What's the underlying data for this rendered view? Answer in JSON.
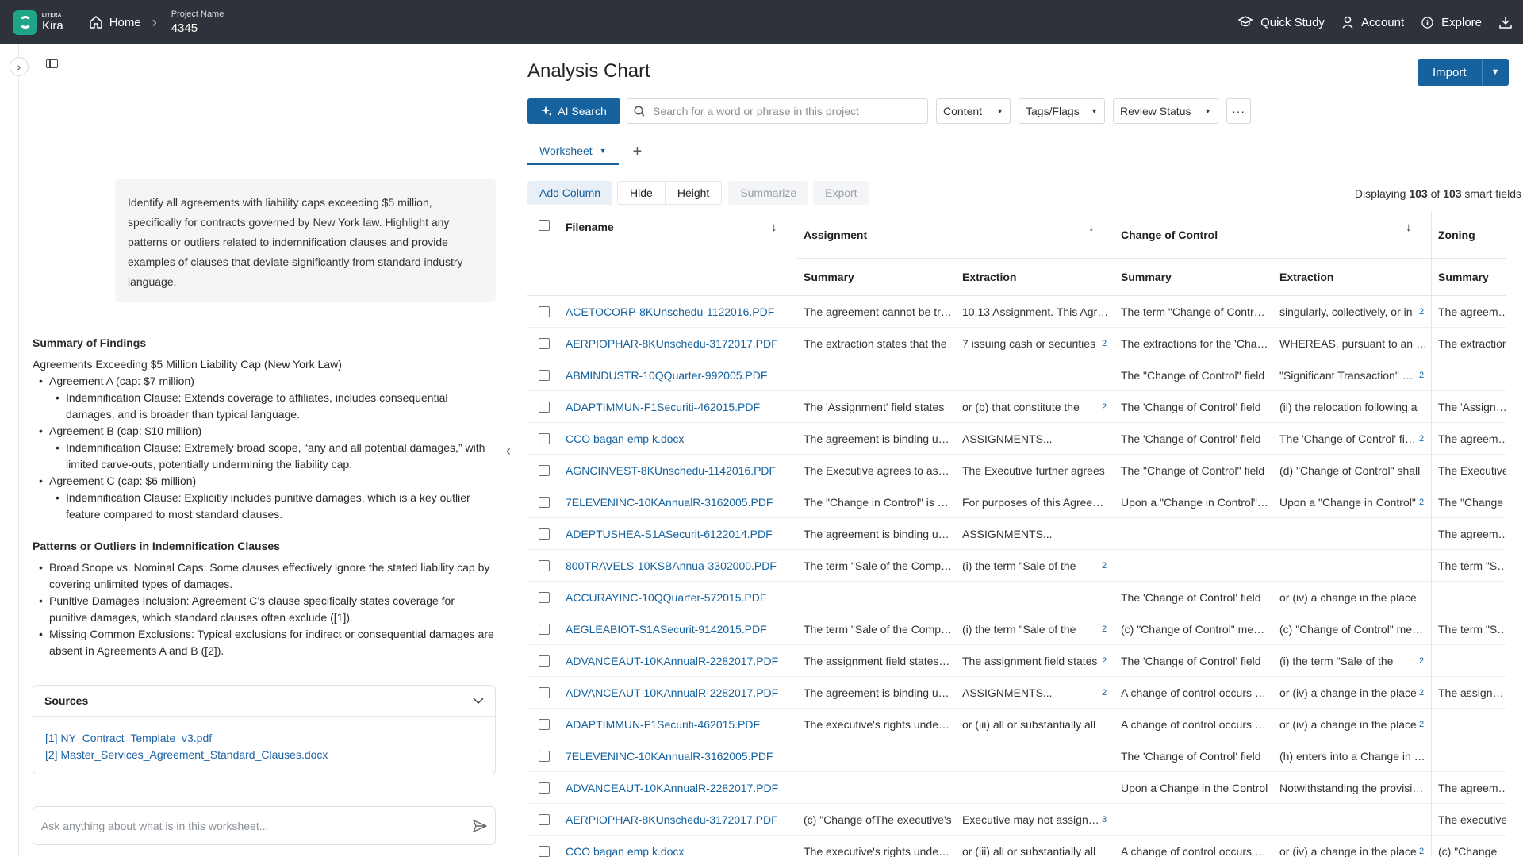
{
  "topbar": {
    "brand_small": "LITERA",
    "brand_name": "Kira",
    "home_label": "Home",
    "project_label": "Project Name",
    "project_value": "4345",
    "quick_study": "Quick Study",
    "account": "Account",
    "explore": "Explore"
  },
  "left": {
    "prompt": "Identify all agreements with liability caps exceeding $5 million, specifically for contracts governed by New York law. Highlight any patterns or outliers related to indemnification clauses and provide examples of clauses that deviate significantly from standard industry language.",
    "summary_heading": "Summary of Findings",
    "summary_intro": "Agreements Exceeding $5 Million Liability Cap (New York Law)",
    "agreement_a": "Agreement A (cap: $7 million)",
    "agreement_a_clause": "Indemnification Clause: Extends coverage to affiliates, includes consequential damages, and is broader than typical language.",
    "agreement_b": "Agreement B (cap: $10 million)",
    "agreement_b_clause": "Indemnification Clause: Extremely broad scope, “any and all potential damages,” with limited carve-outs, potentially undermining the liability cap.",
    "agreement_c": "Agreement C (cap: $6 million)",
    "agreement_c_clause": "Indemnification Clause: Explicitly includes punitive damages, which is a key outlier feature compared to most standard clauses.",
    "patterns_heading": "Patterns or Outliers in Indemnification Clauses",
    "pattern_1": "Broad Scope vs. Nominal Caps: Some clauses effectively ignore the stated liability cap by covering unlimited types of damages.",
    "pattern_2": "Punitive Damages Inclusion: Agreement C’s clause specifically states coverage for punitive damages, which standard clauses often exclude ([1]).",
    "pattern_3": "Missing Common Exclusions: Typical exclusions for indirect or consequential damages are absent in Agreements A and B ([2]).",
    "sources_title": "Sources",
    "source_1": "[1] NY_Contract_Template_v3.pdf",
    "source_2": "[2] Master_Services_Agreement_Standard_Clauses.docx",
    "ask_placeholder": "Ask anything about what is in this worksheet..."
  },
  "main": {
    "title": "Analysis Chart",
    "import_label": "Import",
    "ai_search_label": "AI Search",
    "search_placeholder": "Search for a word or phrase in this project",
    "filter_content": "Content",
    "filter_tags": "Tags/Flags",
    "filter_review": "Review Status",
    "more_label": "···",
    "tab_worksheet": "Worksheet",
    "add_tab": "+",
    "btn_add_column": "Add Column",
    "btn_hide": "Hide",
    "btn_height": "Height",
    "btn_summarize": "Summarize",
    "btn_export": "Export",
    "display_prefix": "Displaying",
    "display_shown": "103",
    "display_of": "of",
    "display_total": "103",
    "display_suffix": "smart fields"
  },
  "table": {
    "col_filename": "Filename",
    "col_assignment": "Assignment",
    "col_change_of_control": "Change of Control",
    "col_zoning": "Zoning",
    "sub_summary": "Summary",
    "sub_extraction": "Extraction",
    "rows": [
      {
        "file": "ACETOCORP-8KUnschedu-1122016.PDF",
        "a_sum": "The agreement cannot be transferred",
        "a_ext": "10.13 Assignment. This Agreement",
        "a_badge": "",
        "c_sum": "The term \"Change of Control\" means",
        "c_ext": "singularly, collectively, or in",
        "c_badge": "2",
        "z_sum": "The agreement"
      },
      {
        "file": "AERPIOPHAR-8KUnschedu-3172017.PDF",
        "a_sum": "The extraction states that the",
        "a_ext": "7 issuing cash or securities",
        "a_badge": "2",
        "c_sum": "The extractions for the 'Change",
        "c_ext": "WHEREAS, pursuant to an agreement",
        "c_badge": "",
        "z_sum": "The extraction"
      },
      {
        "file": "ABMINDUSTR-10QQuarter-992005.PDF",
        "a_sum": "",
        "a_ext": "",
        "a_badge": "",
        "c_sum": "The \"Change of Control\" field",
        "c_ext": "\"Significant Transaction\" means",
        "c_badge": "2",
        "z_sum": ""
      },
      {
        "file": "ADAPTIMMUN-F1Securiti-462015.PDF",
        "a_sum": "The 'Assignment' field states",
        "a_ext": "or (b) that constitute the",
        "a_badge": "2",
        "c_sum": "The 'Change of Control' field",
        "c_ext": "(ii) the relocation following a",
        "c_badge": "",
        "z_sum": "The 'Assignment'"
      },
      {
        "file": "CCO bagan emp k.docx",
        "a_sum": "The agreement is binding upon",
        "a_ext": "ASSIGNMENTS...",
        "a_badge": "",
        "c_sum": "The 'Change of Control' field",
        "c_ext": "The 'Change of Control' field",
        "c_badge": "2",
        "z_sum": "The agreement"
      },
      {
        "file": "AGNCINVEST-8KUnschedu-1142016.PDF",
        "a_sum": "The Executive agrees to assign",
        "a_ext": "The Executive further agrees",
        "a_badge": "",
        "c_sum": "The \"Change of Control\" field",
        "c_ext": "(d) \"Change of Control\" shall",
        "c_badge": "",
        "z_sum": "The Executive"
      },
      {
        "file": "7ELEVENINC-10KAnnualR-3162005.PDF",
        "a_sum": "The \"Change in Control\" is defined",
        "a_ext": "For purposes of this Agreement",
        "a_badge": "",
        "c_sum": "Upon a \"Change in Control\" the",
        "c_ext": "Upon a \"Change in Control\"",
        "c_badge": "2",
        "z_sum": "The \"Change"
      },
      {
        "file": "ADEPTUSHEA-S1ASecurit-6122014.PDF",
        "a_sum": "The agreement is binding upon",
        "a_ext": "ASSIGNMENTS...",
        "a_badge": "",
        "c_sum": "",
        "c_ext": "",
        "c_badge": "",
        "z_sum": "The agreement"
      },
      {
        "file": "800TRAVELS-10KSBAnnua-3302000.PDF",
        "a_sum": "The term \"Sale of the Company\"",
        "a_ext": "(i) the term \"Sale of the",
        "a_badge": "2",
        "c_sum": "",
        "c_ext": "",
        "c_badge": "",
        "z_sum": "The term \"Sale"
      },
      {
        "file": "ACCURAYINC-10QQuarter-572015.PDF",
        "a_sum": "",
        "a_ext": "",
        "a_badge": "",
        "c_sum": "The 'Change of Control' field",
        "c_ext": "or (iv) a change in the place",
        "c_badge": "",
        "z_sum": ""
      },
      {
        "file": "AEGLEABIOT-S1ASecurit-9142015.PDF",
        "a_sum": "The term \"Sale of the Company\"",
        "a_ext": "(i) the term \"Sale of the",
        "a_badge": "2",
        "c_sum": "(c) \"Change of Control\" means",
        "c_ext": "(c) \"Change of Control\" means",
        "c_badge": "",
        "z_sum": "The term \"Sale"
      },
      {
        "file": "ADVANCEAUT-10KAnnualR-2282017.PDF",
        "a_sum": "The assignment field states that",
        "a_ext": "The assignment field states",
        "a_badge": "2",
        "c_sum": "The 'Change of Control' field",
        "c_ext": "(i) the term \"Sale of the",
        "c_badge": "2",
        "z_sum": ""
      },
      {
        "file": "ADVANCEAUT-10KAnnualR-2282017.PDF",
        "a_sum": "The agreement is binding upon",
        "a_ext": "ASSIGNMENTS...",
        "a_badge": "2",
        "c_sum": "A change of control occurs when",
        "c_ext": "or (iv) a change in the place",
        "c_badge": "2",
        "z_sum": "The assignment"
      },
      {
        "file": "ADAPTIMMUN-F1Securiti-462015.PDF",
        "a_sum": "The executive's rights under this",
        "a_ext": "or (iii) all or substantially all",
        "a_badge": "",
        "c_sum": "A change of control occurs when",
        "c_ext": "or (iv) a change in the place",
        "c_badge": "2",
        "z_sum": ""
      },
      {
        "file": "7ELEVENINC-10KAnnualR-3162005.PDF",
        "a_sum": "",
        "a_ext": "",
        "a_badge": "",
        "c_sum": "The 'Change of Control' field",
        "c_ext": "(h) enters into a Change in Control",
        "c_badge": "",
        "z_sum": ""
      },
      {
        "file": "ADVANCEAUT-10KAnnualR-2282017.PDF",
        "a_sum": "",
        "a_ext": "",
        "a_badge": "",
        "c_sum": "Upon a Change in the Control",
        "c_ext": "Notwithstanding the provisions",
        "c_badge": "",
        "z_sum": "The agreement"
      },
      {
        "file": "AERPIOPHAR-8KUnschedu-3172017.PDF",
        "a_sum": "(c) \"Change ofThe executive's",
        "a_ext": "Executive may not assign this",
        "a_badge": "3",
        "c_sum": "",
        "c_ext": "",
        "c_badge": "",
        "z_sum": "The executive"
      },
      {
        "file": "CCO bagan emp k.docx",
        "a_sum": "The executive's rights under this",
        "a_ext": "or (iii) all or substantially all",
        "a_badge": "",
        "c_sum": "A change of control occurs when",
        "c_ext": "or (iv) a change in the place",
        "c_badge": "2",
        "z_sum": "(c) \"Change"
      }
    ]
  }
}
